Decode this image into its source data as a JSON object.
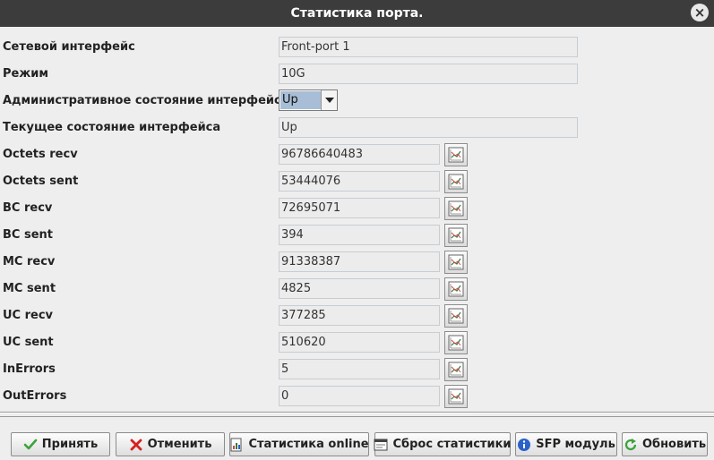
{
  "window": {
    "title": "Статистика порта."
  },
  "fields": [
    {
      "label": "Сетевой интерфейс",
      "value": "Front-port 1"
    },
    {
      "label": "Режим",
      "value": "10G"
    },
    {
      "label": "Административное состояние интерфейса",
      "value": "Up"
    },
    {
      "label": "Текущее состояние интерфейса",
      "value": "Up"
    }
  ],
  "counters": [
    {
      "label": "Octets recv",
      "value": "96786640483"
    },
    {
      "label": "Octets sent",
      "value": "53444076"
    },
    {
      "label": "BC recv",
      "value": "72695071"
    },
    {
      "label": "BC sent",
      "value": "394"
    },
    {
      "label": "MC recv",
      "value": "91338387"
    },
    {
      "label": "MC sent",
      "value": "4825"
    },
    {
      "label": "UC recv",
      "value": "377285"
    },
    {
      "label": "UC sent",
      "value": "510620"
    },
    {
      "label": "InErrors",
      "value": "5"
    },
    {
      "label": "OutErrors",
      "value": "0"
    }
  ],
  "buttons": {
    "accept": "Принять",
    "cancel": "Отменить",
    "online": "Статистика online",
    "reset": "Сброс статистики",
    "sfp": "SFP модуль",
    "refresh": "Обновить"
  },
  "icons": {
    "close": "close-icon",
    "graph": "chart-icon",
    "accept": "checkmark-icon",
    "cancel": "cross-icon",
    "online": "document-chart-icon",
    "reset": "window-reset-icon",
    "sfp": "info-icon",
    "refresh": "refresh-icon"
  },
  "colors": {
    "titlebar": "#3c3c3c",
    "combo_selection": "#a8bed6",
    "accept_green": "#3aa33a",
    "cancel_red": "#d42020",
    "info_blue": "#2a62c9"
  }
}
